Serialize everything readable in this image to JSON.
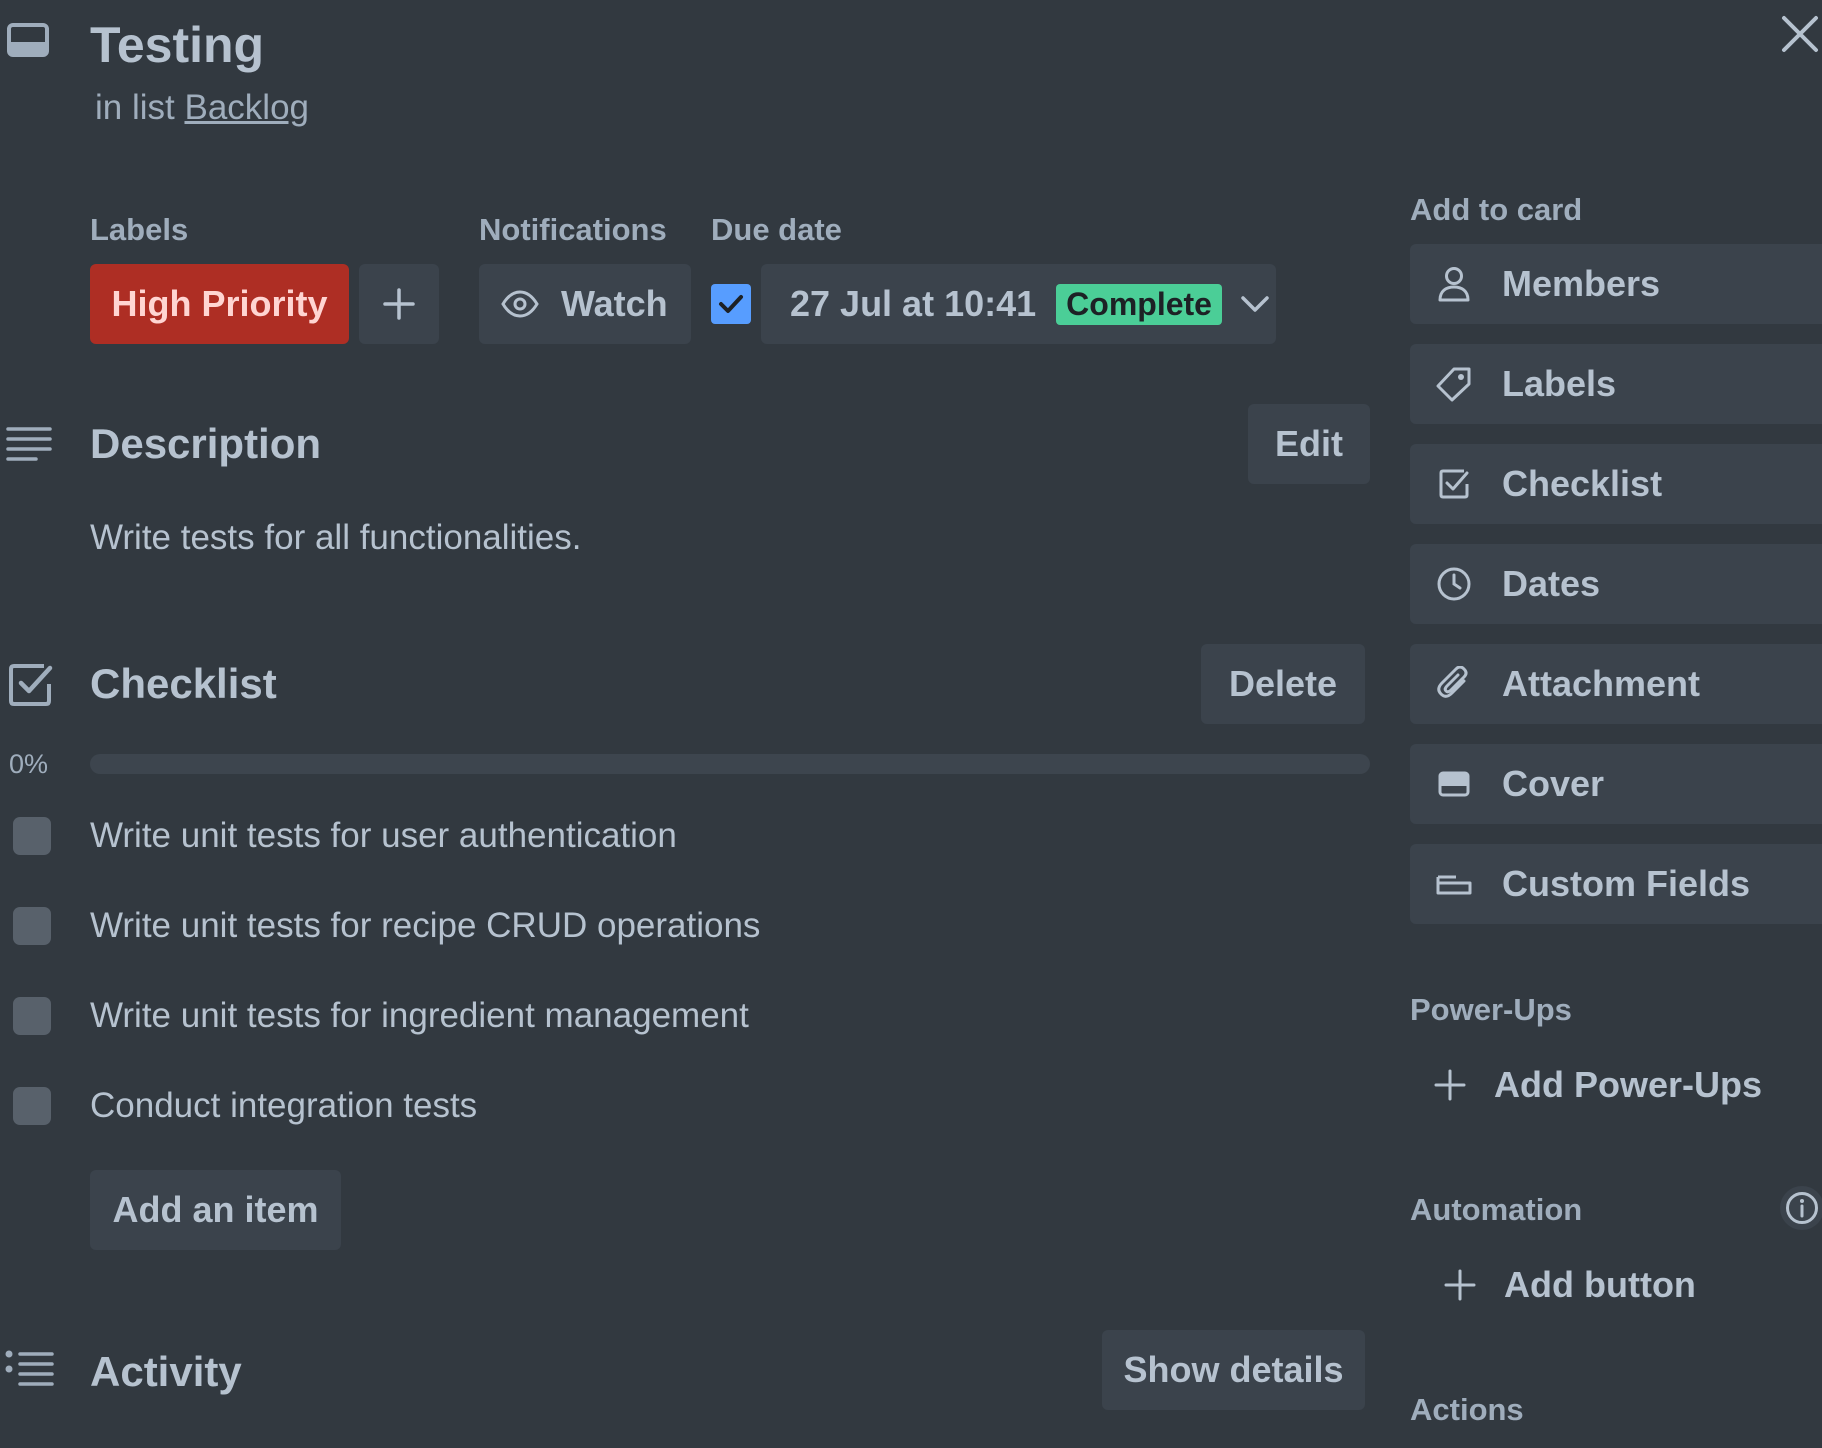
{
  "card": {
    "title": "Testing",
    "in_list_prefix": "in list",
    "list_name": "Backlog"
  },
  "labels": {
    "heading": "Labels",
    "items": [
      {
        "text": "High Priority",
        "color": "#ae2e24"
      }
    ]
  },
  "notifications": {
    "heading": "Notifications",
    "watch_label": "Watch"
  },
  "due_date": {
    "heading": "Due date",
    "checked": true,
    "value": "27 Jul at 10:41",
    "status": "Complete",
    "status_color": "#4bce97"
  },
  "description": {
    "heading": "Description",
    "edit_label": "Edit",
    "text": "Write tests for all functionalities."
  },
  "checklist": {
    "heading": "Checklist",
    "delete_label": "Delete",
    "progress_text": "0%",
    "progress": 0,
    "items": [
      {
        "text": "Write unit tests for user authentication",
        "checked": false
      },
      {
        "text": "Write unit tests for recipe CRUD operations",
        "checked": false
      },
      {
        "text": "Write unit tests for ingredient management",
        "checked": false
      },
      {
        "text": "Conduct integration tests",
        "checked": false
      }
    ],
    "add_item_label": "Add an item"
  },
  "activity": {
    "heading": "Activity",
    "show_details_label": "Show details"
  },
  "sidebar": {
    "add_to_card_heading": "Add to card",
    "add_to_card": [
      {
        "label": "Members",
        "icon": "person-icon"
      },
      {
        "label": "Labels",
        "icon": "tag-icon"
      },
      {
        "label": "Checklist",
        "icon": "checklist-icon"
      },
      {
        "label": "Dates",
        "icon": "clock-icon"
      },
      {
        "label": "Attachment",
        "icon": "paperclip-icon"
      },
      {
        "label": "Cover",
        "icon": "cover-icon"
      },
      {
        "label": "Custom Fields",
        "icon": "custom-fields-icon"
      }
    ],
    "power_ups_heading": "Power-Ups",
    "add_power_ups_label": "Add Power-Ups",
    "automation_heading": "Automation",
    "add_button_label": "Add button",
    "actions_heading": "Actions"
  },
  "colors": {
    "background": "#323940",
    "button": "#3b434c",
    "text": "#b6c2cf",
    "accent_blue": "#579dff",
    "label_red": "#ae2e24"
  }
}
